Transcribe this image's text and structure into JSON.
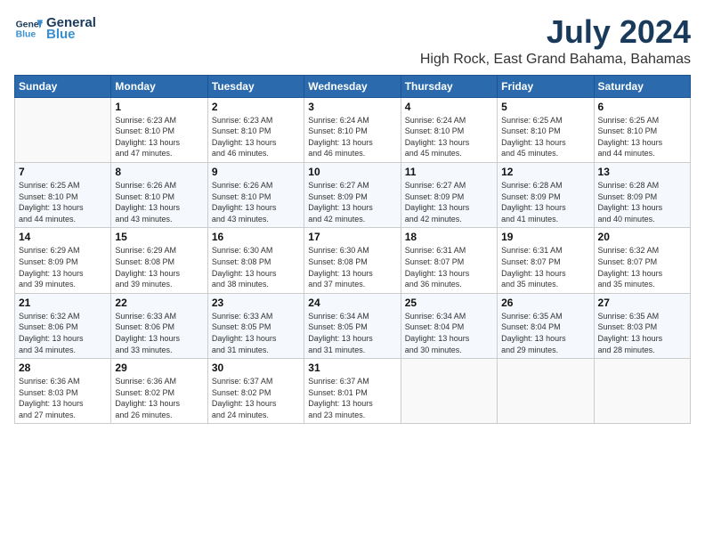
{
  "logo": {
    "line1": "General",
    "line2": "Blue"
  },
  "title": "July 2024",
  "location": "High Rock, East Grand Bahama, Bahamas",
  "weekdays": [
    "Sunday",
    "Monday",
    "Tuesday",
    "Wednesday",
    "Thursday",
    "Friday",
    "Saturday"
  ],
  "weeks": [
    [
      {
        "day": "",
        "info": ""
      },
      {
        "day": "1",
        "info": "Sunrise: 6:23 AM\nSunset: 8:10 PM\nDaylight: 13 hours\nand 47 minutes."
      },
      {
        "day": "2",
        "info": "Sunrise: 6:23 AM\nSunset: 8:10 PM\nDaylight: 13 hours\nand 46 minutes."
      },
      {
        "day": "3",
        "info": "Sunrise: 6:24 AM\nSunset: 8:10 PM\nDaylight: 13 hours\nand 46 minutes."
      },
      {
        "day": "4",
        "info": "Sunrise: 6:24 AM\nSunset: 8:10 PM\nDaylight: 13 hours\nand 45 minutes."
      },
      {
        "day": "5",
        "info": "Sunrise: 6:25 AM\nSunset: 8:10 PM\nDaylight: 13 hours\nand 45 minutes."
      },
      {
        "day": "6",
        "info": "Sunrise: 6:25 AM\nSunset: 8:10 PM\nDaylight: 13 hours\nand 44 minutes."
      }
    ],
    [
      {
        "day": "7",
        "info": "Sunrise: 6:25 AM\nSunset: 8:10 PM\nDaylight: 13 hours\nand 44 minutes."
      },
      {
        "day": "8",
        "info": "Sunrise: 6:26 AM\nSunset: 8:10 PM\nDaylight: 13 hours\nand 43 minutes."
      },
      {
        "day": "9",
        "info": "Sunrise: 6:26 AM\nSunset: 8:10 PM\nDaylight: 13 hours\nand 43 minutes."
      },
      {
        "day": "10",
        "info": "Sunrise: 6:27 AM\nSunset: 8:09 PM\nDaylight: 13 hours\nand 42 minutes."
      },
      {
        "day": "11",
        "info": "Sunrise: 6:27 AM\nSunset: 8:09 PM\nDaylight: 13 hours\nand 42 minutes."
      },
      {
        "day": "12",
        "info": "Sunrise: 6:28 AM\nSunset: 8:09 PM\nDaylight: 13 hours\nand 41 minutes."
      },
      {
        "day": "13",
        "info": "Sunrise: 6:28 AM\nSunset: 8:09 PM\nDaylight: 13 hours\nand 40 minutes."
      }
    ],
    [
      {
        "day": "14",
        "info": "Sunrise: 6:29 AM\nSunset: 8:09 PM\nDaylight: 13 hours\nand 39 minutes."
      },
      {
        "day": "15",
        "info": "Sunrise: 6:29 AM\nSunset: 8:08 PM\nDaylight: 13 hours\nand 39 minutes."
      },
      {
        "day": "16",
        "info": "Sunrise: 6:30 AM\nSunset: 8:08 PM\nDaylight: 13 hours\nand 38 minutes."
      },
      {
        "day": "17",
        "info": "Sunrise: 6:30 AM\nSunset: 8:08 PM\nDaylight: 13 hours\nand 37 minutes."
      },
      {
        "day": "18",
        "info": "Sunrise: 6:31 AM\nSunset: 8:07 PM\nDaylight: 13 hours\nand 36 minutes."
      },
      {
        "day": "19",
        "info": "Sunrise: 6:31 AM\nSunset: 8:07 PM\nDaylight: 13 hours\nand 35 minutes."
      },
      {
        "day": "20",
        "info": "Sunrise: 6:32 AM\nSunset: 8:07 PM\nDaylight: 13 hours\nand 35 minutes."
      }
    ],
    [
      {
        "day": "21",
        "info": "Sunrise: 6:32 AM\nSunset: 8:06 PM\nDaylight: 13 hours\nand 34 minutes."
      },
      {
        "day": "22",
        "info": "Sunrise: 6:33 AM\nSunset: 8:06 PM\nDaylight: 13 hours\nand 33 minutes."
      },
      {
        "day": "23",
        "info": "Sunrise: 6:33 AM\nSunset: 8:05 PM\nDaylight: 13 hours\nand 31 minutes."
      },
      {
        "day": "24",
        "info": "Sunrise: 6:34 AM\nSunset: 8:05 PM\nDaylight: 13 hours\nand 31 minutes."
      },
      {
        "day": "25",
        "info": "Sunrise: 6:34 AM\nSunset: 8:04 PM\nDaylight: 13 hours\nand 30 minutes."
      },
      {
        "day": "26",
        "info": "Sunrise: 6:35 AM\nSunset: 8:04 PM\nDaylight: 13 hours\nand 29 minutes."
      },
      {
        "day": "27",
        "info": "Sunrise: 6:35 AM\nSunset: 8:03 PM\nDaylight: 13 hours\nand 28 minutes."
      }
    ],
    [
      {
        "day": "28",
        "info": "Sunrise: 6:36 AM\nSunset: 8:03 PM\nDaylight: 13 hours\nand 27 minutes."
      },
      {
        "day": "29",
        "info": "Sunrise: 6:36 AM\nSunset: 8:02 PM\nDaylight: 13 hours\nand 26 minutes."
      },
      {
        "day": "30",
        "info": "Sunrise: 6:37 AM\nSunset: 8:02 PM\nDaylight: 13 hours\nand 24 minutes."
      },
      {
        "day": "31",
        "info": "Sunrise: 6:37 AM\nSunset: 8:01 PM\nDaylight: 13 hours\nand 23 minutes."
      },
      {
        "day": "",
        "info": ""
      },
      {
        "day": "",
        "info": ""
      },
      {
        "day": "",
        "info": ""
      }
    ]
  ]
}
